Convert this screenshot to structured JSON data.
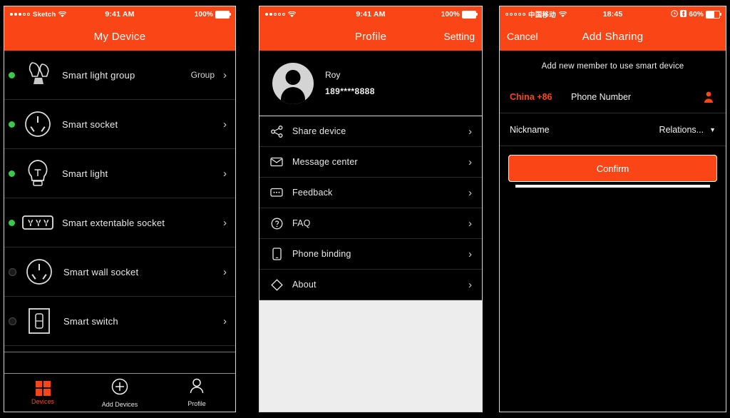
{
  "theme": {
    "accent": "#fa4616",
    "screen_bg": "#000000",
    "text": "#e9e9e9",
    "status_on": "#3cc84a",
    "gray_area": "#ededed"
  },
  "screens": [
    {
      "id": "my-device",
      "status_bar": {
        "carrier": "Sketch",
        "time": "9:41 AM",
        "battery_text": "100%",
        "wifi_icon": "wifi-icon",
        "battery_icon": "battery-icon",
        "signal_icon": "signal-dots-icon"
      },
      "nav": {
        "title": "My Device"
      },
      "devices": [
        {
          "name": "Smart light group",
          "sub": "Group",
          "online": true,
          "icon": "light-group-icon"
        },
        {
          "name": "Smart socket",
          "sub": "",
          "online": true,
          "icon": "socket-icon"
        },
        {
          "name": "Smart light",
          "sub": "",
          "online": true,
          "icon": "bulb-icon"
        },
        {
          "name": "Smart extentable socket",
          "sub": "",
          "online": true,
          "icon": "power-strip-icon"
        },
        {
          "name": "Smart wall socket",
          "sub": "",
          "online": false,
          "icon": "wall-socket-icon"
        },
        {
          "name": "Smart switch",
          "sub": "",
          "online": false,
          "icon": "switch-icon"
        }
      ],
      "tabs": [
        {
          "label": "Devices",
          "icon": "grid-icon",
          "active": true
        },
        {
          "label": "Add Devices",
          "icon": "plus-circle-icon",
          "active": false
        },
        {
          "label": "Profile",
          "icon": "person-icon",
          "active": false
        }
      ]
    },
    {
      "id": "profile",
      "status_bar": {
        "carrier": "",
        "time": "9:41 AM",
        "battery_text": "100%",
        "wifi_icon": "wifi-icon",
        "battery_icon": "battery-icon",
        "signal_icon": "signal-dots-icon"
      },
      "nav": {
        "title": "Profile",
        "right_action": "Setting"
      },
      "user": {
        "name": "Roy",
        "phone": "189****8888",
        "avatar": "avatar-placeholder"
      },
      "menu": [
        {
          "label": "Share device",
          "icon": "share-icon"
        },
        {
          "label": "Message center",
          "icon": "envelope-icon"
        },
        {
          "label": "Feedback",
          "icon": "chat-icon"
        },
        {
          "label": "FAQ",
          "icon": "question-circle-icon"
        },
        {
          "label": "Phone binding",
          "icon": "phone-icon"
        },
        {
          "label": "About",
          "icon": "diamond-icon"
        }
      ]
    },
    {
      "id": "add-sharing",
      "status_bar": {
        "carrier": "中国移动",
        "time": "18:45",
        "battery_text": "60%",
        "wifi_icon": "wifi-icon",
        "battery_icon": "battery-icon",
        "signal_icon": "signal-dots-icon",
        "extra_icons": [
          "alarm-icon",
          "bluetooth-icon"
        ]
      },
      "nav": {
        "left_action": "Cancel",
        "title": "Add Sharing"
      },
      "subtitle": "Add new member to use smart device",
      "form": {
        "country_code": "China +86",
        "phone_placeholder": "Phone Number",
        "contact_icon": "contact-book-icon",
        "nickname_placeholder": "Nickname",
        "relations_value": "Relations...",
        "relations_caret": "chevron-down-icon",
        "confirm_label": "Confirm"
      }
    }
  ]
}
